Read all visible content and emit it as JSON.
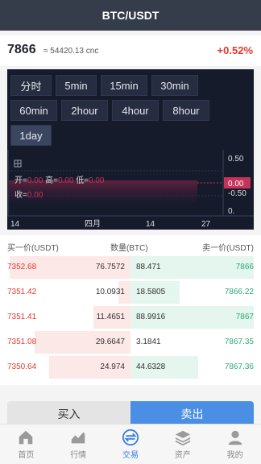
{
  "header": {
    "title": "BTC/USDT"
  },
  "ticker": {
    "last": "7866",
    "cny": "≈ 54420.13 cnc",
    "change": "+0.52%"
  },
  "timeframes": [
    "分时",
    "5min",
    "15min",
    "30min",
    "60min",
    "2hour",
    "4hour",
    "8hour",
    "1day"
  ],
  "active_timeframe": "1day",
  "kline": {
    "open_label": "开=",
    "open": "0.00",
    "high_label": "高=",
    "high": "0.00",
    "low_label": "低=",
    "low": "0.00",
    "close_label": "收=",
    "close": "0.00",
    "y_ticks": [
      "0.50",
      "0.00",
      "-0.50",
      "0."
    ],
    "x_ticks": [
      "14",
      "四月",
      "14",
      "27"
    ]
  },
  "book": {
    "bid_header": "买一价(USDT)",
    "qty_header": "数量(BTC)",
    "ask_header": "卖一价(USDT)",
    "rows": [
      {
        "bid_price": "7352.68",
        "bid_qty": "76.7572",
        "ask_qty": "88.471",
        "ask_price": "7866",
        "bid_depth": 0.98,
        "ask_depth": 1.0
      },
      {
        "bid_price": "7351.42",
        "bid_qty": "10.0931",
        "ask_qty": "18.5805",
        "ask_price": "7866.22",
        "bid_depth": 0.1,
        "ask_depth": 0.4
      },
      {
        "bid_price": "7351.41",
        "bid_qty": "11.4651",
        "ask_qty": "88.9916",
        "ask_price": "7867",
        "bid_depth": 0.3,
        "ask_depth": 1.0
      },
      {
        "bid_price": "7351.08",
        "bid_qty": "29.6647",
        "ask_qty": "3.1841",
        "ask_price": "7867.35",
        "bid_depth": 0.78,
        "ask_depth": 0.0
      },
      {
        "bid_price": "7350.64",
        "bid_qty": "24.974",
        "ask_qty": "44.6328",
        "ask_price": "7867.36",
        "bid_depth": 0.66,
        "ask_depth": 0.55
      }
    ]
  },
  "actions": {
    "buy": "买入",
    "sell": "卖出"
  },
  "tabs": [
    {
      "label": "首页",
      "icon": "home-icon"
    },
    {
      "label": "行情",
      "icon": "chart-icon"
    },
    {
      "label": "交易",
      "icon": "trade-icon"
    },
    {
      "label": "资产",
      "icon": "assets-icon"
    },
    {
      "label": "我的",
      "icon": "user-icon"
    }
  ],
  "active_tab": "交易"
}
